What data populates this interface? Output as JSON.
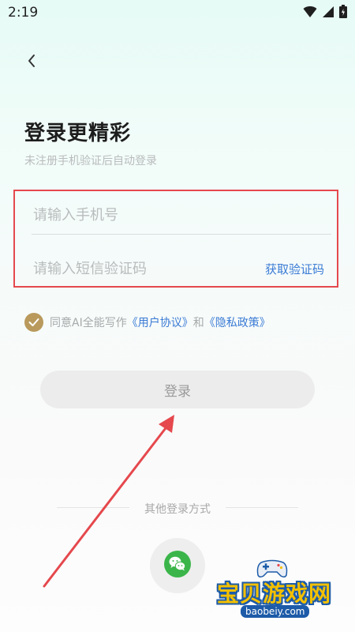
{
  "status_bar": {
    "time": "2:19",
    "icons": [
      "wifi-icon",
      "signal-icon",
      "battery-icon"
    ]
  },
  "header": {
    "back_icon": "chevron-left-icon"
  },
  "title": "登录更精彩",
  "subtitle": "未注册手机验证后自动登录",
  "phone_input": {
    "placeholder": "请输入手机号",
    "value": ""
  },
  "code_input": {
    "placeholder": "请输入短信验证码",
    "value": ""
  },
  "get_code_label": "获取验证码",
  "agreement": {
    "checked": true,
    "prefix": "同意AI全能写作",
    "user_agreement": "《用户协议》",
    "and": "和",
    "privacy_policy": "《隐私政策》"
  },
  "login_label": "登录",
  "other_login_label": "其他登录方式",
  "other_login_methods": [
    "wechat-icon"
  ],
  "watermark": {
    "title": "宝贝游戏网",
    "url": "baobeiy.com"
  },
  "colors": {
    "highlight_box": "#e5484d",
    "link": "#3a7bd5",
    "checkbox": "#b99a5c",
    "wechat": "#3bb54a"
  }
}
